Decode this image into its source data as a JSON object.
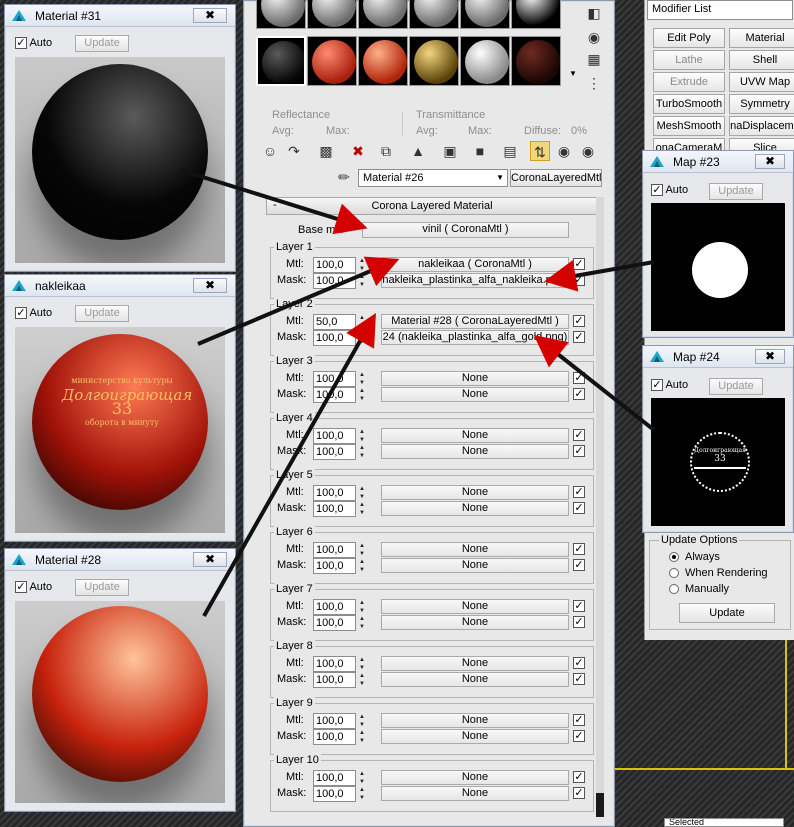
{
  "material_editor": {
    "sample_slots": [
      {
        "color_a": "#f4f4f4",
        "color_b": "#6b6b6b"
      },
      {
        "color_a": "#f4f4f4",
        "color_b": "#6b6b6b"
      },
      {
        "color_a": "#f4f4f4",
        "color_b": "#6b6b6b"
      },
      {
        "color_a": "#f4f4f4",
        "color_b": "#6b6b6b"
      },
      {
        "color_a": "#f4f4f4",
        "color_b": "#6b6b6b"
      },
      {
        "color_a": "#ffffff",
        "color_b": "#000000"
      },
      {
        "color_a": "#5a5a5a",
        "color_b": "#050505"
      },
      {
        "color_a": "#ff8a70",
        "color_b": "#a8200e"
      },
      {
        "color_a": "#ffb08a",
        "color_b": "#b0240a"
      },
      {
        "color_a": "#f2d680",
        "color_b": "#5c4208"
      },
      {
        "color_a": "#ffffff",
        "color_b": "#8a8a8a"
      },
      {
        "color_a": "#6e2a22",
        "color_b": "#1c0604"
      }
    ],
    "reflectance_label": "Reflectance",
    "transmittance_label": "Transmittance",
    "avg_label": "Avg:",
    "max_label": "Max:",
    "diffuse_label": "Diffuse:",
    "diffuse_value": "0%",
    "material_name": "Material #26",
    "material_type": "CoronaLayeredMtl",
    "rollout_title": "Corona Layered Material",
    "rollout_collapse": "-",
    "base_mtl_label": "Base mtl:",
    "base_mtl_value": "vinil  ( CoronaMtl )",
    "mtl_label": "Mtl:",
    "mask_label": "Mask:",
    "layers": [
      {
        "name": "Layer 1",
        "mtl_amount": "100,0",
        "mask_amount": "100,0",
        "mtl": "nakleikaa  ( CoronaMtl )",
        "mask": "nakleika_plastinka_alfa_nakleika.png)"
      },
      {
        "name": "Layer 2",
        "mtl_amount": "50,0",
        "mask_amount": "100,0",
        "mtl": "Material #28  ( CoronaLayeredMtl )",
        "mask": "24 (nakleika_plastinka_alfa_gold.png)"
      },
      {
        "name": "Layer 3",
        "mtl_amount": "100,0",
        "mask_amount": "100,0",
        "mtl": "None",
        "mask": "None"
      },
      {
        "name": "Layer 4",
        "mtl_amount": "100,0",
        "mask_amount": "100,0",
        "mtl": "None",
        "mask": "None"
      },
      {
        "name": "Layer 5",
        "mtl_amount": "100,0",
        "mask_amount": "100,0",
        "mtl": "None",
        "mask": "None"
      },
      {
        "name": "Layer 6",
        "mtl_amount": "100,0",
        "mask_amount": "100,0",
        "mtl": "None",
        "mask": "None"
      },
      {
        "name": "Layer 7",
        "mtl_amount": "100,0",
        "mask_amount": "100,0",
        "mtl": "None",
        "mask": "None"
      },
      {
        "name": "Layer 8",
        "mtl_amount": "100,0",
        "mask_amount": "100,0",
        "mtl": "None",
        "mask": "None"
      },
      {
        "name": "Layer 9",
        "mtl_amount": "100,0",
        "mask_amount": "100,0",
        "mtl": "None",
        "mask": "None"
      },
      {
        "name": "Layer 10",
        "mtl_amount": "100,0",
        "mask_amount": "100,0",
        "mtl": "None",
        "mask": "None"
      }
    ]
  },
  "previews": [
    {
      "title": "Material #31",
      "auto_label": "Auto",
      "update_label": "Update",
      "sphere_highlight": "#5a5a5a",
      "sphere_base": "#060606",
      "bg": "#c9c9c9"
    },
    {
      "title": "nakleikaa",
      "auto_label": "Auto",
      "update_label": "Update",
      "sphere_highlight": "#ff7a55",
      "sphere_base": "#a11208",
      "bg": "#cfcfcf",
      "label_top": "министерство культуры",
      "label_title": "Долгоиграющая",
      "label_number": "33",
      "label_bottom": "оборота в минуту"
    },
    {
      "title": "Material #28",
      "auto_label": "Auto",
      "update_label": "Update",
      "sphere_highlight": "#ffc49a",
      "sphere_base": "#c8230d",
      "bg": "#cdcdcd"
    }
  ],
  "maps": [
    {
      "title": "Map #23",
      "auto_label": "Auto",
      "update_label": "Update"
    },
    {
      "title": "Map #24",
      "auto_label": "Auto",
      "update_label": "Update",
      "disc_title": "Долгоиграющая",
      "disc_number": "33"
    }
  ],
  "modifier_panel": {
    "list_label": "Modifier List",
    "buttons": [
      "Edit Poly",
      "Material",
      "Lathe",
      "Shell",
      "Extrude",
      "UVW Map",
      "TurboSmooth",
      "Symmetry",
      "MeshSmooth",
      "naDisplaceme",
      "onaCameraM",
      "Slice"
    ],
    "update_options_label": "Update Options",
    "radios": [
      {
        "label": "Always",
        "checked": true
      },
      {
        "label": "When Rendering",
        "checked": false
      },
      {
        "label": "Manually",
        "checked": false
      }
    ],
    "update_button": "Update",
    "bottom_select": "Selected"
  }
}
